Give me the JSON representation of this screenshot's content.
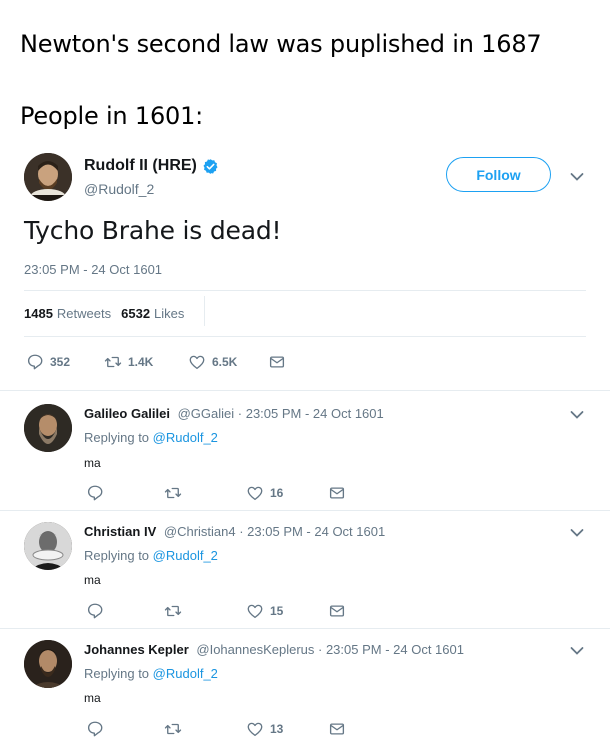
{
  "caption": {
    "line1": "Newton's second law was puplished in 1687",
    "line2": "People in 1601:"
  },
  "tweet": {
    "name": "Rudolf II (HRE)",
    "handle": "@Rudolf_2",
    "follow_label": "Follow",
    "text": "Tycho Brahe is dead!",
    "timestamp": "23:05 PM - 24 Oct 1601",
    "retweets_count": "1485",
    "retweets_label": "Retweets",
    "likes_count": "6532",
    "likes_label": "Likes",
    "actions": {
      "replies": "352",
      "retweets": "1.4K",
      "likes": "6.5K"
    },
    "verified_icon": "verified-badge-icon",
    "accent_color": "#1da1f2"
  },
  "replies": [
    {
      "name": "Galileo Galilei",
      "handle": "@GGaliei",
      "timestamp": "· 23:05 PM - 24 Oct 1601",
      "replying_prefix": "Replying to",
      "replying_to": "@Rudolf_2",
      "text": "ma",
      "likes": "16"
    },
    {
      "name": "Christian IV",
      "handle": "@Christian4",
      "timestamp": "· 23:05 PM - 24 Oct 1601",
      "replying_prefix": "Replying to",
      "replying_to": "@Rudolf_2",
      "text": "ma",
      "likes": "15"
    },
    {
      "name": "Johannes Kepler",
      "handle": "@IohannesKeplerus",
      "timestamp": "· 23:05 PM - 24 Oct 1601",
      "replying_prefix": "Replying to",
      "replying_to": "@Rudolf_2",
      "text": "ma",
      "likes": "13"
    }
  ]
}
